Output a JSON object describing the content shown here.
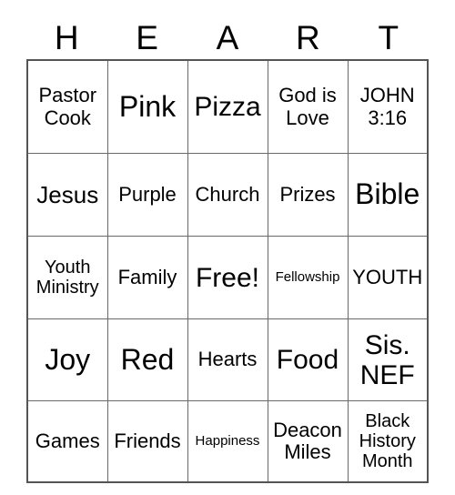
{
  "card": {
    "title_letters": [
      "H",
      "E",
      "A",
      "R",
      "T"
    ],
    "grid_size": "5x5",
    "colors": {
      "text": "#000000",
      "cell_border": "#6a6a6a",
      "outer_border": "#555555",
      "background": "#ffffff"
    },
    "rows": [
      [
        {
          "text": "Pastor Cook",
          "size": "md"
        },
        {
          "text": "Pink",
          "size": "xxl"
        },
        {
          "text": "Pizza",
          "size": "xl"
        },
        {
          "text": "God is Love",
          "size": "md"
        },
        {
          "text": "JOHN 3:16",
          "size": "md"
        }
      ],
      [
        {
          "text": "Jesus",
          "size": "lg"
        },
        {
          "text": "Purple",
          "size": "md"
        },
        {
          "text": "Church",
          "size": "md"
        },
        {
          "text": "Prizes",
          "size": "md"
        },
        {
          "text": "Bible",
          "size": "xxl"
        }
      ],
      [
        {
          "text": "Youth Ministry",
          "size": "sm"
        },
        {
          "text": "Family",
          "size": "md"
        },
        {
          "text": "Free!",
          "size": "xl"
        },
        {
          "text": "Fellowship",
          "size": "xs"
        },
        {
          "text": "YOUTH",
          "size": "md"
        }
      ],
      [
        {
          "text": "Joy",
          "size": "xxl"
        },
        {
          "text": "Red",
          "size": "xxl"
        },
        {
          "text": "Hearts",
          "size": "md"
        },
        {
          "text": "Food",
          "size": "xl"
        },
        {
          "text": "Sis. NEF",
          "size": "xl"
        }
      ],
      [
        {
          "text": "Games",
          "size": "md"
        },
        {
          "text": "Friends",
          "size": "md"
        },
        {
          "text": "Happiness",
          "size": "xs"
        },
        {
          "text": "Deacon Miles",
          "size": "md"
        },
        {
          "text": "Black History Month",
          "size": "sm"
        }
      ]
    ]
  }
}
